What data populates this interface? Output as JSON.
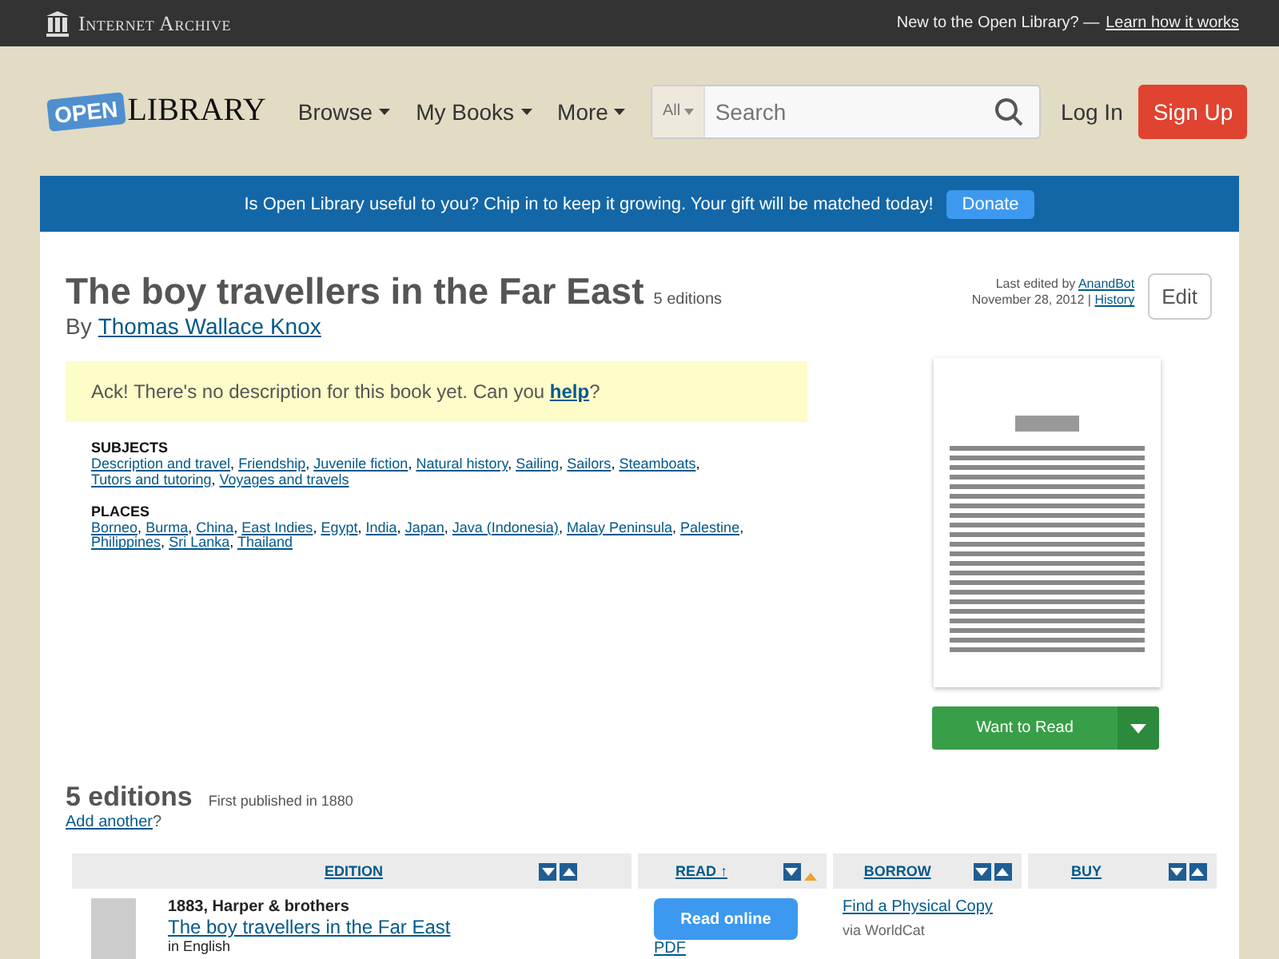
{
  "top_bar": {
    "brand": "Internet Archive",
    "prompt": "New to the Open Library? —",
    "link": "Learn how it works"
  },
  "header": {
    "logo_badge": "OPEN",
    "logo_word": "LIBRARY",
    "nav": [
      "Browse",
      "My Books",
      "More"
    ],
    "search": {
      "scope": "All",
      "placeholder": "Search"
    },
    "login": "Log In",
    "signup": "Sign Up"
  },
  "banner": {
    "text": "Is Open Library useful to you? Chip in to keep it growing. Your gift will be matched today!",
    "button": "Donate"
  },
  "work": {
    "title": "The boy travellers in the Far East",
    "edition_count": "5 editions",
    "by": "By",
    "author": "Thomas Wallace Knox",
    "last_edited_prefix": "Last edited by",
    "last_edited_by": "AnandBot",
    "edit_date": "November 28, 2012 |",
    "history": "History",
    "edit_button": "Edit",
    "description_text": "Ack! There's no description for this book yet. Can you",
    "description_link": "help",
    "description_end": "?",
    "separator": ",",
    "subjects_heading": "SUBJECTS",
    "subjects": [
      "Description and travel",
      "Friendship",
      "Juvenile fiction",
      "Natural history",
      "Sailing",
      "Sailors",
      "Steamboats",
      "Tutors and tutoring",
      "Voyages and travels"
    ],
    "places_heading": "PLACES",
    "places": [
      "Borneo",
      "Burma",
      "China",
      "East Indies",
      "Egypt",
      "India",
      "Japan",
      "Java (Indonesia)",
      "Malay Peninsula",
      "Palestine",
      "Philippines",
      "Sri Lanka",
      "Thailand"
    ],
    "want_to_read": "Want to Read"
  },
  "editions": {
    "heading": "5 editions",
    "first_published": "First published in 1880",
    "add_link": "Add another",
    "add_end": "?",
    "columns": [
      {
        "label": "EDITION",
        "sort_active": false
      },
      {
        "label": "READ ↑",
        "sort_active": true
      },
      {
        "label": "BORROW",
        "sort_active": false
      },
      {
        "label": "BUY",
        "sort_active": false
      }
    ],
    "rows": [
      {
        "publisher": "1883, Harper & brothers",
        "title": "The boy travellers in the Far East",
        "language": "in English",
        "read_button": "Read online",
        "format": "PDF",
        "borrow_link": "Find a Physical Copy",
        "borrow_via": "via WorldCat"
      }
    ]
  }
}
